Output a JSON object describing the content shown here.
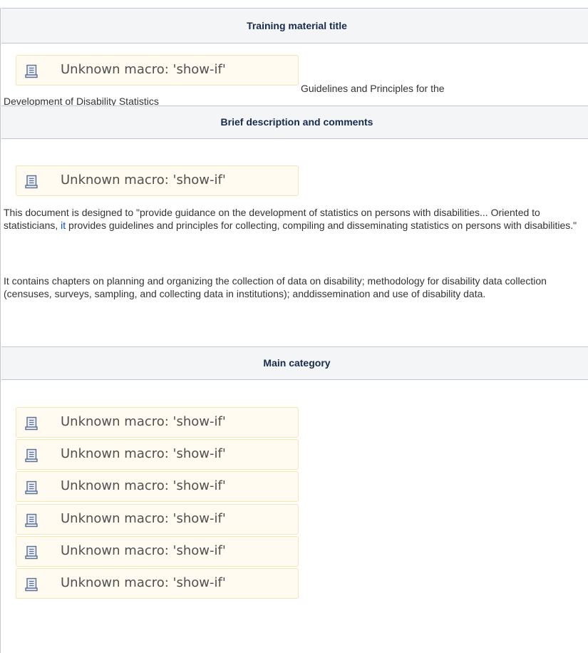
{
  "sections": {
    "title_header": "Training material title",
    "description_header": "Brief description and comments",
    "category_header": "Main category"
  },
  "macro_label": "Unknown macro: 'show-if'",
  "icon": "scroll-macro-icon",
  "title_text": {
    "line1": "Guidelines and Principles for the",
    "line2": "Development of Disability Statistics"
  },
  "description": {
    "p1_before_link": "This document is designed to \"provide guidance on the development of statistics on persons with disabilities... Oriented to statisticians, ",
    "p1_link": "it",
    "p1_after_link": " provides guidelines and principles for collecting, compiling and disseminating statistics on persons with disabilities.\"",
    "p2": "It contains chapters on planning and organizing the collection of data on disability; methodology for disability data collection (censuses, surveys, sampling, and collecting data in institutions); anddissemination and use of disability data."
  },
  "colors": {
    "header_bg": "#f4f5f7",
    "border": "#c1c7d0",
    "macro_bg": "#fffbf0",
    "macro_border": "#f5e6b5",
    "link": "#0052cc"
  }
}
